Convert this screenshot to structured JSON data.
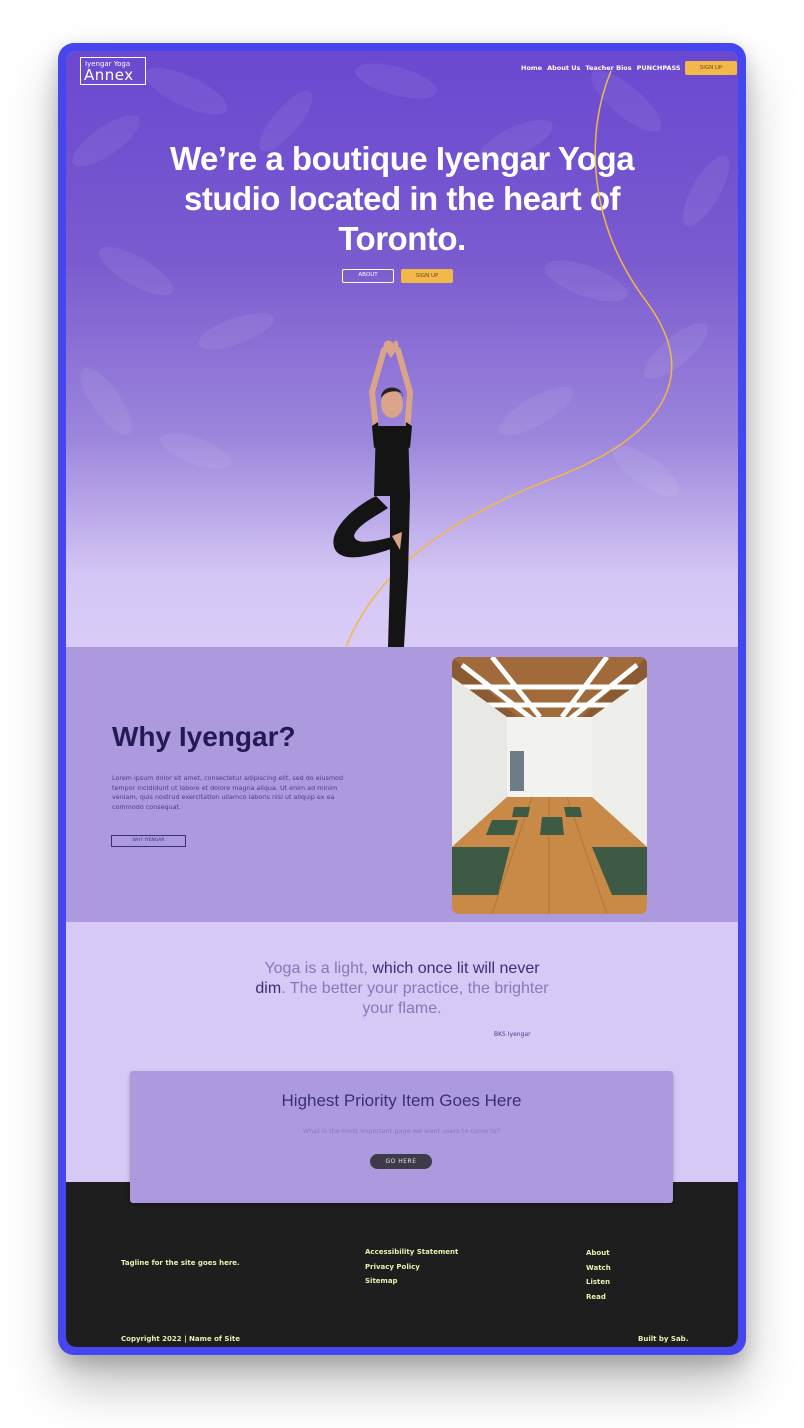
{
  "logo": {
    "line1": "Iyengar Yoga",
    "line2": "Annex"
  },
  "nav": {
    "items": [
      "Home",
      "About Us",
      "Teacher Bios",
      "PUNCHPASS"
    ],
    "signup": "SIGN UP"
  },
  "hero": {
    "headline_1": "We’re a ",
    "headline_2": "boutique Iyengar Yoga studio",
    "headline_3": " located in the heart of Toronto.",
    "about_button": "ABOUT",
    "signup_button": "SIGN UP"
  },
  "why": {
    "title": "Why Iyengar?",
    "text": "Lorem ipsum dolor sit amet, consectetur adipiscing elit, sed do eiusmod tempor incididunt ut labore et dolore magna aliqua. Ut enim ad minim veniam, quis nostrud exercitation ullamco laboris nisi ut aliquip ex ea commodo consequat.",
    "button": "WHY IYENGAR"
  },
  "quote": {
    "part1": "Yoga is a light, ",
    "part2": "which once lit will never dim",
    "part3": ". The better your practice, the brighter your flame.",
    "author": "BKS Iyengar"
  },
  "cta": {
    "title": "Highest Priority Item Goes Here",
    "subtitle": "What is the most important page we want users to come to?",
    "button": "GO HERE"
  },
  "footer": {
    "tagline": "Tagline for the site goes here.",
    "links_col1": [
      "Accessibility Statement",
      "Privacy Policy",
      "Sitemap"
    ],
    "links_col2": [
      "About",
      "Watch",
      "Listen",
      "Read"
    ],
    "copyright": "Copyright 2022 | Name of Site",
    "built_by": "Built by Sab."
  },
  "colors": {
    "frame": "#4646ee",
    "hero_top": "#6a48d0",
    "accent_gold": "#f3b84a",
    "why_bg": "#ad9ade",
    "quote_bg": "#d6c9f5",
    "footer_bg": "#1e1e1e"
  }
}
